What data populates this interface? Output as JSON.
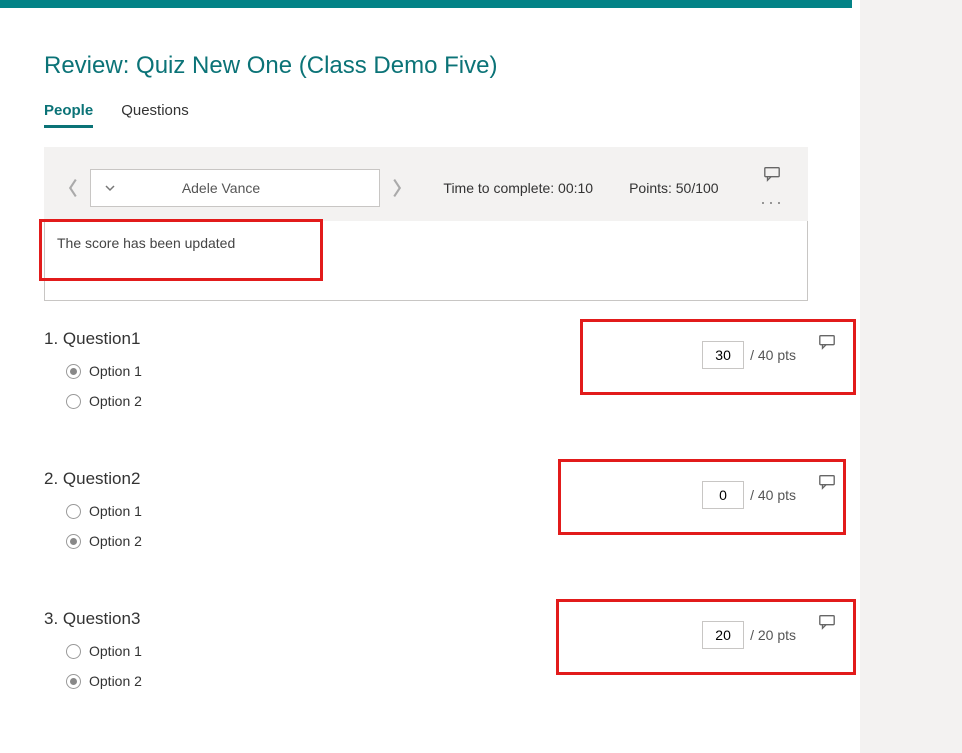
{
  "page_title": "Review: Quiz New One (Class Demo Five)",
  "tabs": {
    "people": "People",
    "questions": "Questions"
  },
  "student": {
    "name": "Adele Vance"
  },
  "meta": {
    "time_label": "Time to complete: 00:10",
    "points_label": "Points: 50/100"
  },
  "notice": "The score has been updated",
  "questions": [
    {
      "number": "1.",
      "title": "Question1",
      "options": [
        "Option 1",
        "Option 2"
      ],
      "selected": 0,
      "score": "30",
      "max": "/ 40 pts"
    },
    {
      "number": "2.",
      "title": "Question2",
      "options": [
        "Option 1",
        "Option 2"
      ],
      "selected": 1,
      "score": "0",
      "max": "/ 40 pts"
    },
    {
      "number": "3.",
      "title": "Question3",
      "options": [
        "Option 1",
        "Option 2"
      ],
      "selected": 1,
      "score": "20",
      "max": "/ 20 pts"
    }
  ]
}
